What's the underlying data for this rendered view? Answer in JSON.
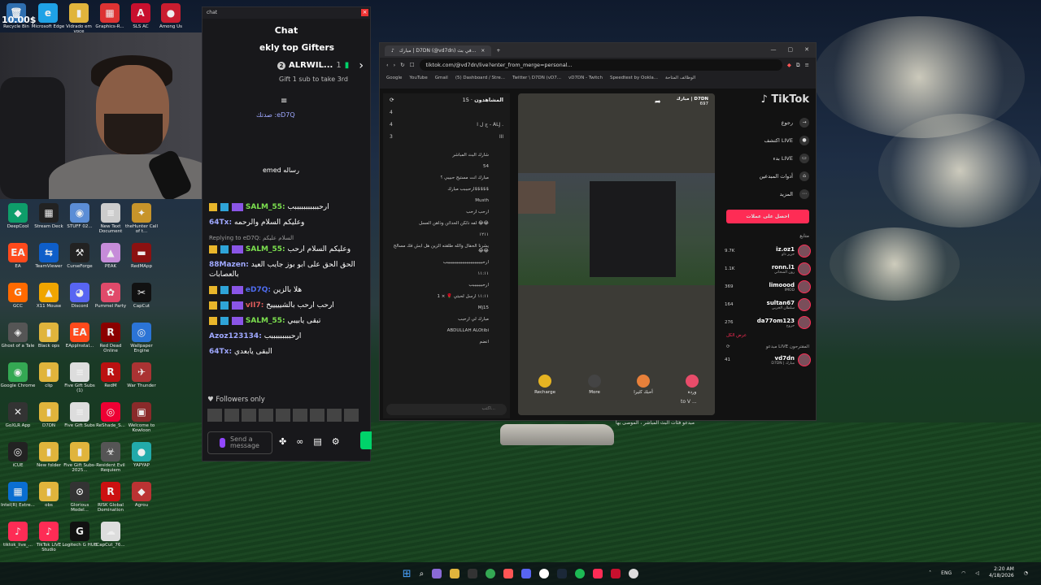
{
  "overlay": {
    "clock": "10.00$"
  },
  "desktop": {
    "icons": [
      {
        "label": "Recycle Bin",
        "glyph": "🗑",
        "color": "#2f6fb0"
      },
      {
        "label": "Microsoft Edge",
        "glyph": "e",
        "color": "#1fa2e6"
      },
      {
        "label": "Vidrado em voce",
        "glyph": "▮",
        "color": "#e0b43c"
      },
      {
        "label": "Graphics-R...",
        "glyph": "▦",
        "color": "#d33"
      },
      {
        "label": "SLS AC",
        "glyph": "A",
        "color": "#c8102e"
      },
      {
        "label": "Among Us",
        "glyph": "●",
        "color": "#c91d2f"
      },
      {
        "label": "DeepCool",
        "glyph": "◆",
        "color": "#0e9d6a"
      },
      {
        "label": "Stream Deck",
        "glyph": "▦",
        "color": "#222"
      },
      {
        "label": "STUFF 02...",
        "glyph": "◉",
        "color": "#5b8dd6"
      },
      {
        "label": "New Text Document",
        "glyph": "≡",
        "color": "#ccc"
      },
      {
        "label": "theHunter Call of t...",
        "glyph": "✦",
        "color": "#c7942a"
      },
      {
        "label": "EA",
        "glyph": "EA",
        "color": "#ff4a1c"
      },
      {
        "label": "TeamViewer",
        "glyph": "⇆",
        "color": "#0e5ec9"
      },
      {
        "label": "CurseForge",
        "glyph": "⚒",
        "color": "#222"
      },
      {
        "label": "PEAK",
        "glyph": "▲",
        "color": "#c68cd9"
      },
      {
        "label": "RedMApp",
        "glyph": "▬",
        "color": "#8b1111"
      },
      {
        "label": "GCC",
        "glyph": "G",
        "color": "#ff6a00"
      },
      {
        "label": "X11 Mouse",
        "glyph": "▲",
        "color": "#f0a500"
      },
      {
        "label": "Discord",
        "glyph": "◕",
        "color": "#5865f2"
      },
      {
        "label": "Pummel Party",
        "glyph": "✿",
        "color": "#e04a6a"
      },
      {
        "label": "CapCut",
        "glyph": "✂",
        "color": "#111"
      },
      {
        "label": "Ghost of a Tale",
        "glyph": "◈",
        "color": "#555"
      },
      {
        "label": "Black ops",
        "glyph": "▮",
        "color": "#e0b43c"
      },
      {
        "label": "EAppInstal...",
        "glyph": "EA",
        "color": "#ff4a1c"
      },
      {
        "label": "Red Dead Online",
        "glyph": "R",
        "color": "#8b0000"
      },
      {
        "label": "Wallpaper Engine",
        "glyph": "◎",
        "color": "#2b74d6"
      },
      {
        "label": "Google Chrome",
        "glyph": "◉",
        "color": "#34a853"
      },
      {
        "label": "clip",
        "glyph": "▮",
        "color": "#e0b43c"
      },
      {
        "label": "Five Gift Subs (1)",
        "glyph": "≡",
        "color": "#ddd"
      },
      {
        "label": "RedM",
        "glyph": "R",
        "color": "#b11"
      },
      {
        "label": "War Thunder",
        "glyph": "✈",
        "color": "#a33"
      },
      {
        "label": "GoXLR App",
        "glyph": "✕",
        "color": "#333"
      },
      {
        "label": "D7DN",
        "glyph": "▮",
        "color": "#e0b43c"
      },
      {
        "label": "Five Gift Subs",
        "glyph": "≡",
        "color": "#ddd"
      },
      {
        "label": "ReShade_S...",
        "glyph": "◎",
        "color": "#e03"
      },
      {
        "label": "Welcome to Kowloon",
        "glyph": "▣",
        "color": "#8a2a2a"
      },
      {
        "label": "iCUE",
        "glyph": "◎",
        "color": "#222"
      },
      {
        "label": "New folder",
        "glyph": "▮",
        "color": "#e0b43c"
      },
      {
        "label": "Five Gift Subs-2025...",
        "glyph": "▮",
        "color": "#e0b43c"
      },
      {
        "label": "Resident Evil Requiem",
        "glyph": "☣",
        "color": "#555"
      },
      {
        "label": "YAPYAP",
        "glyph": "●",
        "color": "#2aa"
      },
      {
        "label": "Intel(R) Extre...",
        "glyph": "▦",
        "color": "#0a6ed1"
      },
      {
        "label": "obs",
        "glyph": "▮",
        "color": "#e0b43c"
      },
      {
        "label": "Glorious Model...",
        "glyph": "⊙",
        "color": "#333"
      },
      {
        "label": "RISK Global Domination",
        "glyph": "R",
        "color": "#c11"
      },
      {
        "label": "Agrou",
        "glyph": "◆",
        "color": "#b33"
      },
      {
        "label": "tiktok_live_...",
        "glyph": "♪",
        "color": "#fe2c55"
      },
      {
        "label": "TikTok LIVE Studio",
        "glyph": "♪",
        "color": "#fe2c55"
      },
      {
        "label": "Logitech G HUB",
        "glyph": "G",
        "color": "#111"
      },
      {
        "label": "CapCut_76...",
        "glyph": "☁",
        "color": "#ddd"
      }
    ]
  },
  "chat": {
    "titlebar": "chat",
    "header": "Chat",
    "gifters_title": "ekly top Gifters",
    "top_gifter_rank": "2",
    "top_gifter_name": "ALRWIL...",
    "top_gifter_count": "1",
    "gift_hint": "Gift 1 sub to take 3rd",
    "messages": [
      {
        "user": "SALM_55:",
        "text": "ارحبببببببببببب",
        "color": "#7ce04f",
        "badges": true
      },
      {
        "user": "64Tx:",
        "text": "وعليكم السلام والرحمه",
        "color": "#9fa8ff",
        "badges": false
      },
      {
        "reply": "Replying to eD7Q: السلام عليكم",
        "user": "SALM_55:",
        "text": "وعليكم السلام ارحب",
        "color": "#7ce04f",
        "badges": true
      },
      {
        "user": "88Mazen:",
        "text": "الحق الحق على ابو بوز جايب العيد بالعصابات",
        "color": "#9fa8ff",
        "badges": false
      },
      {
        "user": "eD7Q:",
        "text": "هلا بالزين",
        "color": "#4f6cf0",
        "badges": true
      },
      {
        "user": "vII7:",
        "text": "ارحب ارحب بالشيييييخ",
        "color": "#e05c5c",
        "badges": true
      },
      {
        "user": "SALM_55:",
        "text": "تبقى يابيبي",
        "color": "#7ce04f",
        "badges": true
      },
      {
        "user": "Azoz123134:",
        "text": "ارحبببببببببب",
        "color": "#9fa8ff",
        "badges": false
      },
      {
        "user": "64Tx:",
        "text": "البقى يابعدي",
        "color": "#9fa8ff",
        "badges": false
      }
    ],
    "followers_only": "Followers only",
    "send_placeholder": "Send a message",
    "partial_lines": [
      "صدتك :eD7Q",
      "emed رساله"
    ]
  },
  "browser": {
    "tab_title": "مبارك | D7DN (@vd7dn) في بث...",
    "url": "tiktok.com/@vd7dn/live?enter_from_merge=personal...",
    "bookmarks": [
      "Google",
      "YouTube",
      "Gmail",
      "(5) Dashboard / Stre...",
      "Twitter \\ D7DN (vD7...",
      "vD7DN - Twitch",
      "Speedtest by Ookla...",
      "الوظائف المتاحة"
    ],
    "viewers_title": "المشاهدون",
    "viewers_count": "15 ·",
    "viewer_rows": [
      {
        "n": "4",
        "name": ""
      },
      {
        "n": "4",
        "name": "ج ل ا - ALJ ."
      },
      {
        "n": "3",
        "name": "ااا"
      }
    ],
    "live_chat": [
      "شارك البث المباشر",
      "54",
      "مبارك انت مستيح حبيبي ؟",
      "ارحبببب مبارك$$$$$",
      "Musth",
      "ارحب ارحب",
      "لفه ذلكن الحداثن وذاهن العسل 😂😂",
      "١٢١١",
      "يشرنا الحفال والله طلقته الزين هل ابش فك مسالح 😂😂",
      "ارحببببببببببببببببببببببببببب",
      "١١:١١",
      "ارحبببببببب",
      "١١:١١ ارسل لحبتي 🌹 × 1",
      "Mj15",
      "مبارك لي ارحبب",
      "ABDULLAH ALOtibi",
      "انضم"
    ],
    "chat_input_placeholder": "اكتب...",
    "streamer_name": "مبارك | D7DN",
    "streamer_likes": "697",
    "gifts": [
      {
        "label": "Recharge",
        "color": "#e6b422"
      },
      {
        "label": "More",
        "color": "#444"
      },
      {
        "label": "أحبك كثيرا",
        "color": "#e8803a"
      },
      {
        "label": "وردة",
        "color": "#e84c6a"
      }
    ],
    "to_v": "to V ...",
    "tiktok_logo": "TikTok",
    "side_nav": [
      {
        "label": "رجوع",
        "glyph": "→"
      },
      {
        "label": "اكتشف LIVE",
        "glyph": "●"
      },
      {
        "label": "بدء LIVE",
        "glyph": "▭"
      },
      {
        "label": "أدوات المبدعين",
        "glyph": "⌂"
      },
      {
        "label": "المزيد",
        "glyph": "⋯"
      }
    ],
    "get_coins": "احصل على عملات",
    "following_title": "متابع",
    "following": [
      {
        "name": "iz.oz1",
        "sub": "حزيز ذاو",
        "count": "9.7K"
      },
      {
        "name": "ronn.l1",
        "sub": "رون الشحاتي",
        "count": "1.1K"
      },
      {
        "name": "limoood",
        "sub": "IMOD",
        "count": "369"
      },
      {
        "name": "sultan67",
        "sub": "سلطان الحربي",
        "count": "164"
      },
      {
        "name": "da77om123",
        "sub": "حروح",
        "count": "276"
      }
    ],
    "show_all": "عرض الكل",
    "suggested_title": "مبدعو LIVE المقترحون",
    "suggested": [
      {
        "name": "vd7dn",
        "sub": "D7DN | مبارك",
        "count": "41"
      }
    ],
    "bottom_strip": "مبدعو فئات البث المباشر ، الموصى بها"
  },
  "taskbar": {
    "lang": "ENG",
    "time": "2:20 AM",
    "date": "4/18/2026"
  }
}
